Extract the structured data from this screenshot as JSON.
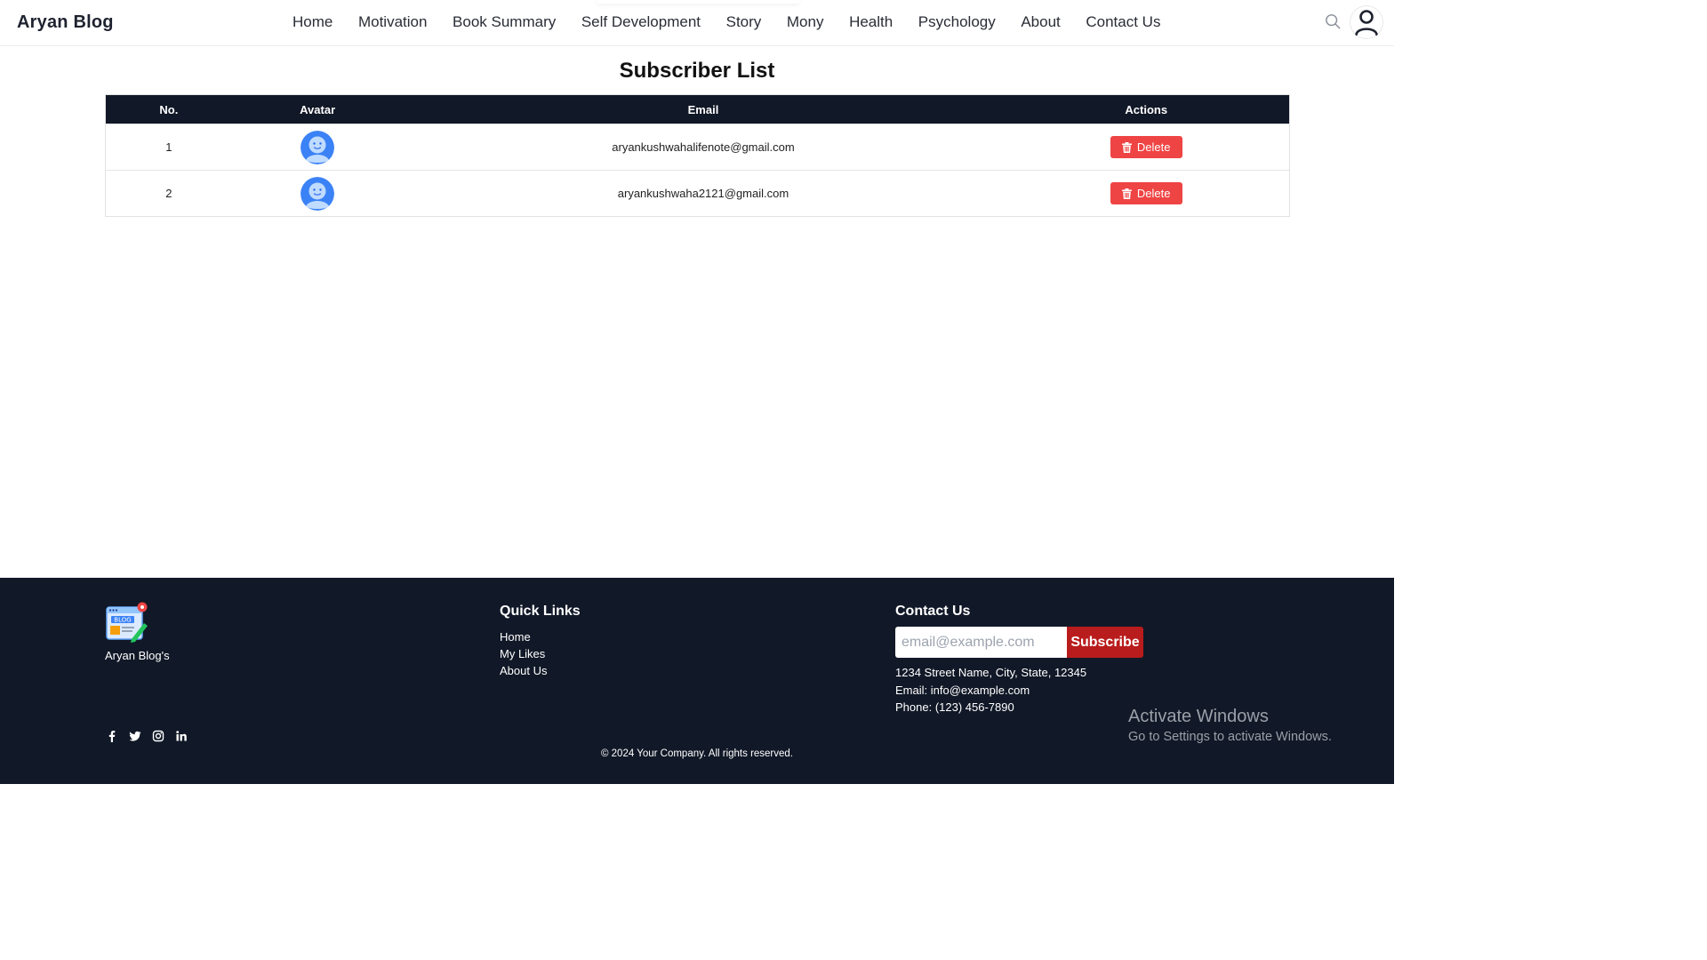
{
  "header": {
    "brand": "Aryan Blog",
    "nav": [
      "Home",
      "Motivation",
      "Book Summary",
      "Self Development",
      "Story",
      "Mony",
      "Health",
      "Psychology",
      "About",
      "Contact Us"
    ],
    "icons": [
      "search-icon",
      "user-icon"
    ]
  },
  "main": {
    "title": "Subscriber List",
    "columns": [
      "No.",
      "Avatar",
      "Email",
      "Actions"
    ],
    "rows": [
      {
        "no": "1",
        "email": "aryankushwahalifenote@gmail.com",
        "action": "Delete"
      },
      {
        "no": "2",
        "email": "aryankushwaha2121@gmail.com",
        "action": "Delete"
      }
    ]
  },
  "footer": {
    "brand": "Aryan Blog's",
    "quick_links_title": "Quick Links",
    "quick_links": [
      "Home",
      "My Likes",
      "About Us"
    ],
    "contact_title": "Contact Us",
    "email_placeholder": "email@example.com",
    "subscribe_label": "Subscribe",
    "address": "1234 Street Name, City, State, 12345",
    "email_line": "Email: info@example.com",
    "phone_line": "Phone: (123) 456-7890",
    "copyright": "© 2024 Your Company. All rights reserved.",
    "socials": [
      "facebook-icon",
      "twitter-icon",
      "instagram-icon",
      "linkedin-icon"
    ]
  },
  "windows_watermark": {
    "line1": "Activate Windows",
    "line2": "Go to Settings to activate Windows."
  },
  "colors": {
    "header_table": "#111827",
    "delete_button": "#ef4444",
    "subscribe_button": "#b91c1c",
    "avatar": "#3b82f6"
  }
}
